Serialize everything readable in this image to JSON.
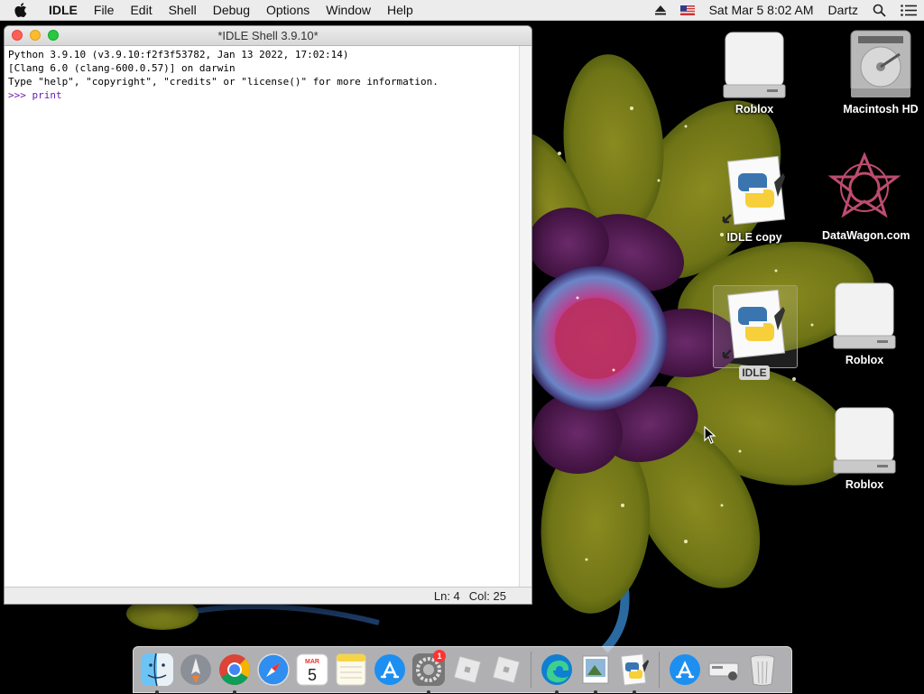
{
  "menubar": {
    "app_name": "IDLE",
    "items": [
      "File",
      "Edit",
      "Shell",
      "Debug",
      "Options",
      "Window",
      "Help"
    ],
    "clock": "Sat Mar 5  8:02 AM",
    "user": "Dartz"
  },
  "window": {
    "title": "*IDLE Shell 3.9.10*",
    "lines": [
      "Python 3.9.10 (v3.9.10:f2f3f53782, Jan 13 2022, 17:02:14)",
      "[Clang 6.0 (clang-600.0.57)] on darwin",
      "Type \"help\", \"copyright\", \"credits\" or \"license()\" for more information."
    ],
    "prompt": ">>> ",
    "input": "print",
    "status_ln": "Ln: 4",
    "status_col": "Col: 25"
  },
  "desktop_icons": [
    {
      "label": "Roblox",
      "kind": "drive"
    },
    {
      "label": "Macintosh HD",
      "kind": "harddisk"
    },
    {
      "label": "IDLE copy",
      "kind": "python-alias"
    },
    {
      "label": "DataWagon.com",
      "kind": "logo"
    },
    {
      "label": "IDLE",
      "kind": "python-alias",
      "selected": true
    },
    {
      "label": "Roblox",
      "kind": "drive"
    },
    {
      "label": "Roblox",
      "kind": "drive"
    }
  ],
  "dock": {
    "calendar_month": "MAR",
    "calendar_day": "5",
    "settings_badge": "1",
    "apps": [
      "finder-icon",
      "launchpad-icon",
      "chrome-icon",
      "safari-icon",
      "calendar-icon",
      "notes-icon",
      "app-store-icon",
      "system-preferences-icon",
      "roblox-icon",
      "roblox-icon",
      "edge-icon",
      "preview-icon",
      "idle-icon",
      "app-store-icon",
      "scanner-icon",
      "trash-icon"
    ]
  }
}
